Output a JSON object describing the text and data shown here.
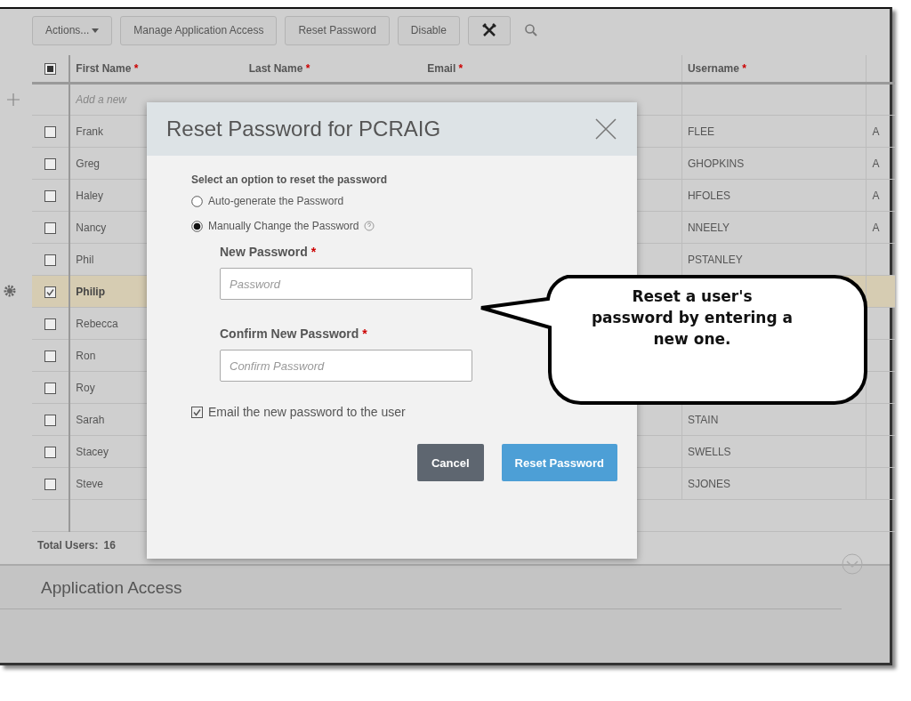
{
  "toolbar": {
    "buttons": [
      {
        "label": "Actions...",
        "kind": "dropdown"
      },
      {
        "label": "Manage Application Access",
        "kind": "text"
      },
      {
        "label": "Reset Password",
        "kind": "text"
      },
      {
        "label": "Disable",
        "kind": "text"
      },
      {
        "kind": "tools"
      }
    ]
  },
  "table": {
    "select_all_checked": true,
    "columns": [
      {
        "label": "First Name",
        "required_mark": "*"
      },
      {
        "label": "Last Name",
        "required_mark": "*"
      },
      {
        "label": "Email",
        "required_mark": "*"
      },
      {
        "label": "Username",
        "required_mark": "*"
      }
    ],
    "add_row": {
      "placeholder": "Add a new"
    },
    "rows": [
      {
        "first_name": "Frank",
        "username": "FLEE",
        "column_6": "A",
        "checked": false,
        "selected": false
      },
      {
        "first_name": "Greg",
        "username": "GHOPKINS",
        "column_6": "A",
        "checked": false,
        "selected": false
      },
      {
        "first_name": "Haley",
        "username": "HFOLES",
        "column_6": "A",
        "checked": false,
        "selected": false
      },
      {
        "first_name": "Nancy",
        "username": "NNEELY",
        "column_6": "A",
        "checked": false,
        "selected": false
      },
      {
        "first_name": "Phil",
        "username": "PSTANLEY",
        "checked": false,
        "selected": false
      },
      {
        "first_name": "Philip",
        "checked": true,
        "selected": true
      },
      {
        "first_name": "Rebecca",
        "checked": false,
        "selected": false
      },
      {
        "first_name": "Ron",
        "checked": false,
        "selected": false
      },
      {
        "first_name": "Roy",
        "checked": false,
        "selected": false
      },
      {
        "first_name": "Sarah",
        "username": "STAIN",
        "checked": false,
        "selected": false
      },
      {
        "first_name": "Stacey",
        "username": "SWELLS",
        "checked": false,
        "selected": false
      },
      {
        "first_name": "Steve",
        "username": "SJONES",
        "checked": false,
        "selected": false
      }
    ],
    "total_label": "Total Users:",
    "total_value": "16"
  },
  "section": {
    "title": "Application Access"
  },
  "dialog": {
    "title": "Reset Password for PCRAIG",
    "prompt": "Select an option to reset the password",
    "options": [
      {
        "label": "Auto-generate the Password",
        "selected": false
      },
      {
        "label": "Manually Change the Password",
        "selected": true
      }
    ],
    "fields": [
      {
        "label": "New Password",
        "required_mark": "*",
        "placeholder": "Password"
      },
      {
        "label": "Confirm New Password",
        "required_mark": "*",
        "placeholder": "Confirm Password"
      }
    ],
    "email_option": {
      "label": "Email the new password to the user",
      "checked": true
    },
    "buttons": [
      {
        "label": "Cancel",
        "kind": "secondary"
      },
      {
        "label": "Reset Password",
        "kind": "primary"
      }
    ]
  },
  "callout": {
    "text": "Reset a user's password by entering a new one."
  }
}
